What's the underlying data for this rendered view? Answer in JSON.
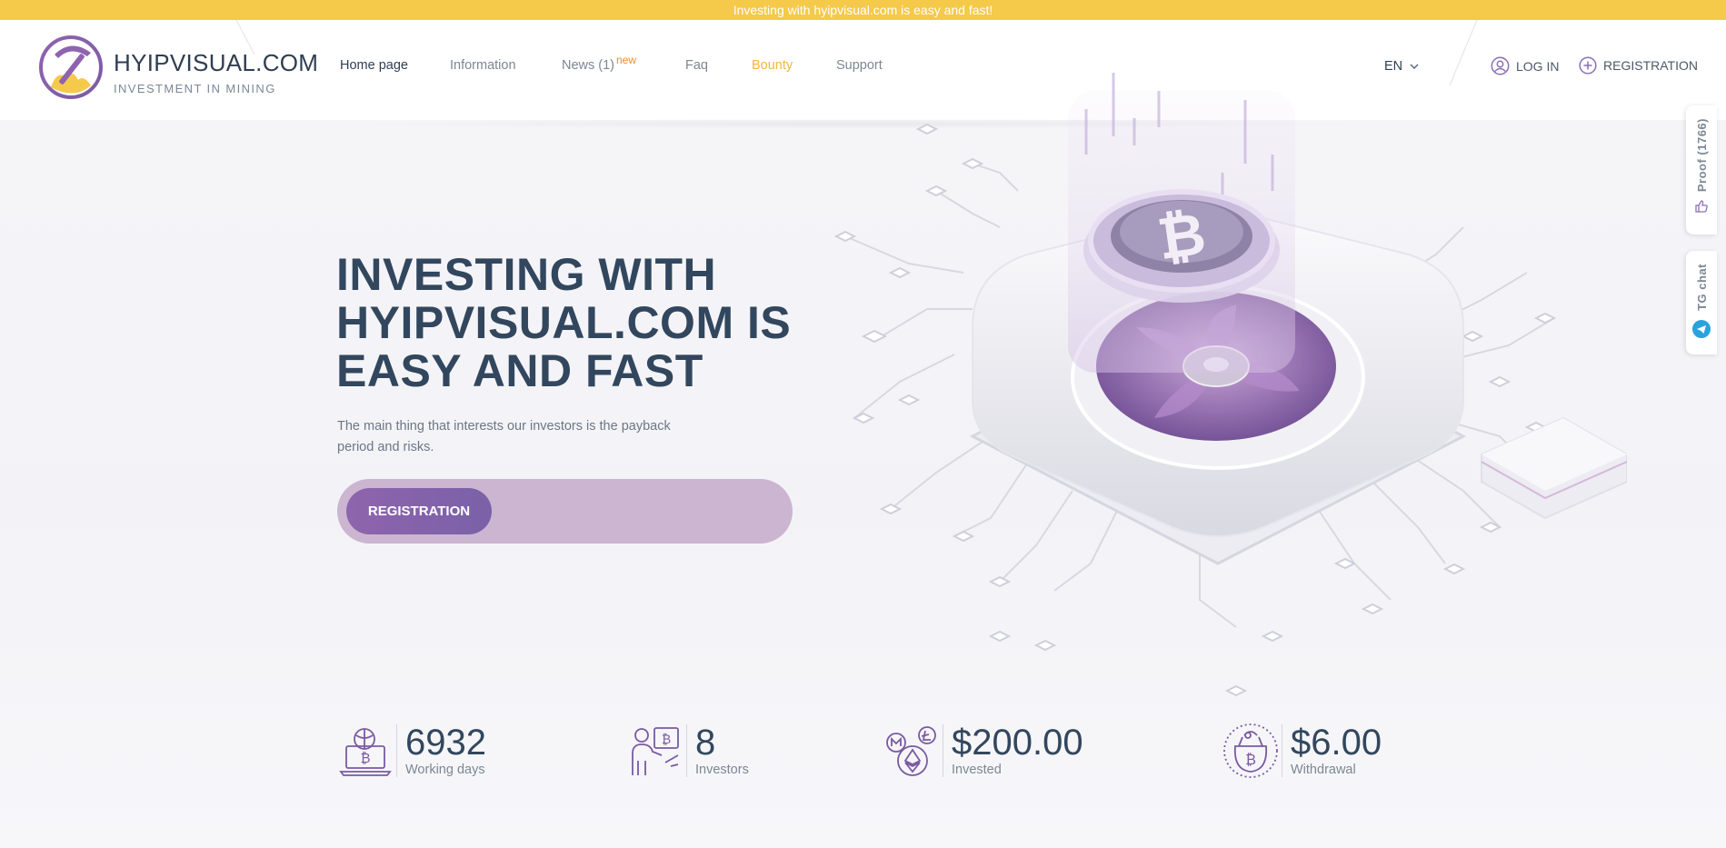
{
  "announcement": "Investing with hyipvisual.com is easy and fast!",
  "header": {
    "brand": "HYIPVISUAL.COM",
    "tagline": "INVESTMENT IN MINING",
    "nav": [
      {
        "label": "Home page"
      },
      {
        "label": "Information"
      },
      {
        "label": "News (1)"
      },
      {
        "label": "Faq"
      },
      {
        "label": "Bounty"
      },
      {
        "label": "Support"
      }
    ],
    "news_badge": "new",
    "language": "EN",
    "login": "LOG IN",
    "registration": "REGISTRATION"
  },
  "side": {
    "proof": "Proof (1766)",
    "tg_chat": "TG chat"
  },
  "hero": {
    "title_line1": "INVESTING WITH",
    "title_line2": "HYIPVISUAL.COM IS",
    "title_line3": "EASY AND FAST",
    "subtitle": "The main thing that interests our investors is the payback period and risks.",
    "cta": "REGISTRATION"
  },
  "stats": [
    {
      "value": "6932",
      "label": "Working days",
      "icon": "laptop-bitcoin-icon"
    },
    {
      "value": "8",
      "label": "Investors",
      "icon": "investor-presentation-icon"
    },
    {
      "value": "$200.00",
      "label": "Invested",
      "icon": "crypto-coins-icon"
    },
    {
      "value": "$6.00",
      "label": "Withdrawal",
      "icon": "bitcoin-wallet-icon"
    }
  ],
  "colors": {
    "announcement_bg": "#f5c94a",
    "accent_purple": "#8e64ad",
    "bounty": "#f3b63b",
    "heading": "#32475e"
  }
}
